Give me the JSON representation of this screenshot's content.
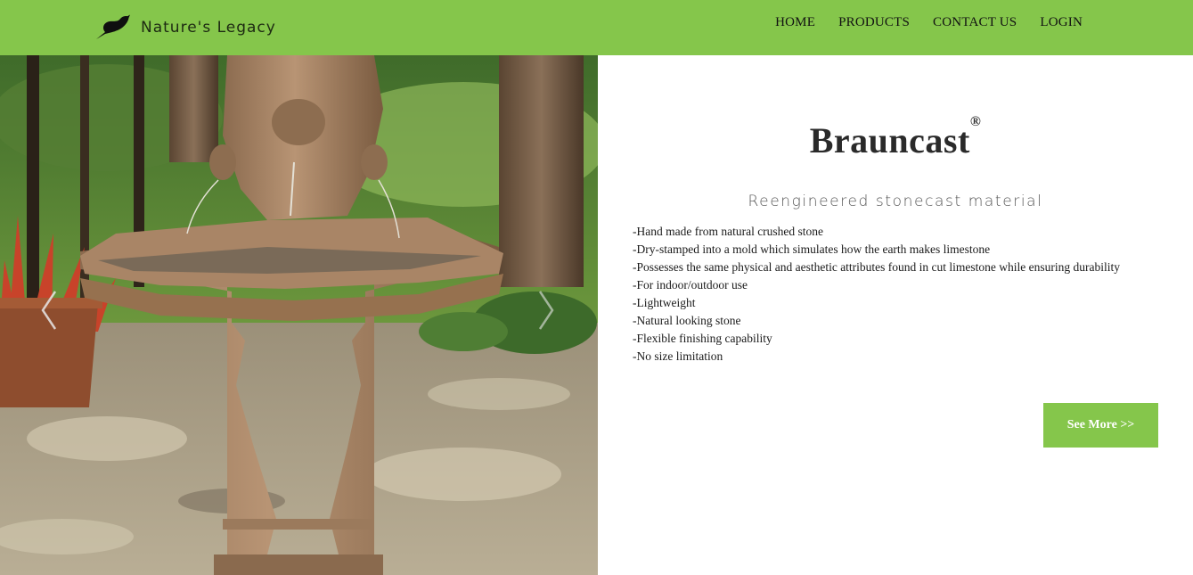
{
  "header": {
    "brand": "Nature's Legacy",
    "nav": [
      "HOME",
      "PRODUCTS",
      "CONTACT US",
      "LOGIN"
    ]
  },
  "colors": {
    "brand_green": "#85c64b",
    "nav_text": "#111111"
  },
  "hero": {
    "image": "garden-fountain-photo",
    "prev_icon": "chevron-left-icon",
    "next_icon": "chevron-right-icon"
  },
  "product": {
    "title": "Brauncast",
    "trademark": "®",
    "subtitle": "Reengineered stonecast material",
    "features": [
      "-Hand made from natural crushed stone",
      "-Dry-stamped into a mold which simulates how the earth makes limestone",
      "-Possesses the same physical and aesthetic attributes found in cut limestone while ensuring durability",
      "-For indoor/outdoor use",
      "-Lightweight",
      "-Natural looking stone",
      "-Flexible finishing capability",
      "-No size limitation"
    ],
    "cta": "See More >>"
  }
}
